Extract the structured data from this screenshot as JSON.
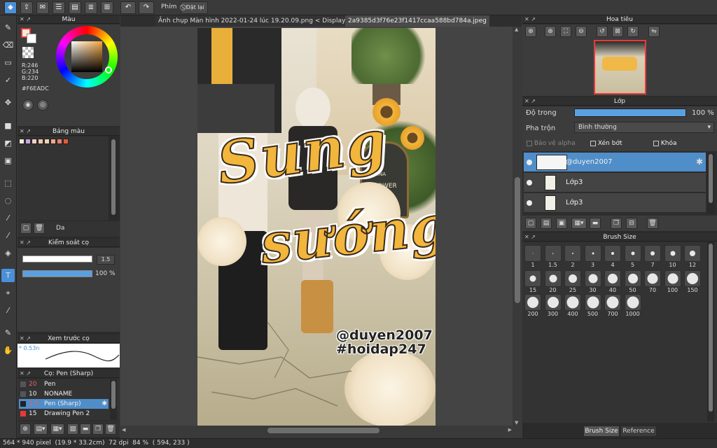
{
  "toolbar": {
    "key_label": "Phím",
    "reset_label": "Đặt lại"
  },
  "tabs": [
    {
      "label": "Ảnh chụp Màn hình 2022-01-24 lúc 19.20.09.png < Display >"
    },
    {
      "label": "2a9385d3f76e23f1417ccaa588bd784a.jpeg"
    }
  ],
  "color_panel": {
    "title": "Màu",
    "r": "R:246",
    "g": "G:234",
    "b": "B:220",
    "hex": "#F6EADC"
  },
  "swatch_panel": {
    "title": "Bảng màu",
    "swatches": [
      "#f6eadc",
      "#c8a8e0",
      "#f0d0c0",
      "#f4c8b0",
      "#f6d0b4",
      "#f0a890",
      "#e8806a",
      "#e85a3a"
    ],
    "name": "Da"
  },
  "brush_control": {
    "title": "Kiểm soát cọ",
    "size_value": "1.5",
    "opacity_value": "100 %"
  },
  "brush_preview": {
    "title": "Xem trước cọ",
    "size_text": "* 0.53n"
  },
  "brush_list": {
    "title": "Cọ: Pen (Sharp)",
    "items": [
      {
        "size": "20",
        "name": "Pen",
        "color": "#e86060"
      },
      {
        "size": "10",
        "name": "NONAME",
        "color": "#dddddd"
      },
      {
        "size": "1.5",
        "name": "Pen (Sharp)",
        "color": "#e86060"
      },
      {
        "size": "15",
        "name": "Drawing Pen 2",
        "color": "#e86060"
      }
    ]
  },
  "navigator": {
    "title": "Hoa tiêu"
  },
  "layer_panel": {
    "title": "Lớp",
    "opacity_label": "Độ trong",
    "opacity_value": "100 %",
    "opacity_fraction": 1.0,
    "blend_label": "Pha trộn",
    "blend_value": "Bình thường",
    "protect_alpha": "Bảo vệ alpha",
    "clipping": "Xén bớt",
    "lock": "Khóa",
    "layers": [
      {
        "name": "@duyen2007"
      },
      {
        "name": "Lớp3"
      },
      {
        "name": "Lớp3"
      }
    ]
  },
  "brush_size_panel": {
    "title": "Brush Size",
    "row1": [
      "1",
      "1.5",
      "2",
      "3",
      "4",
      "5",
      "7",
      "10",
      "12"
    ],
    "row2": [
      "15",
      "20",
      "25",
      "30",
      "40",
      "50",
      "70",
      "100",
      "150"
    ],
    "row3": [
      "200",
      "300",
      "400",
      "500",
      "700",
      "1000"
    ],
    "tab_brush_size": "Brush Size",
    "tab_reference": "Reference"
  },
  "canvas": {
    "headline_line1": "Sung",
    "headline_line2": "sướng",
    "watermark1": "@duyen2007",
    "watermark2": "#hoidap247",
    "sign_line1": "GEMINA",
    "sign_line2": "FLOWER"
  },
  "status_bar": {
    "text": "564 * 940 pixel  (19.9 * 33.2cm)  72 dpi  84 %  ( 594, 233 )"
  },
  "colors": {
    "accent": "#4f8ec9",
    "fg_color": "#f6eadc",
    "bg_color": "#ffffff",
    "title_yellow": "#f2b63c"
  }
}
